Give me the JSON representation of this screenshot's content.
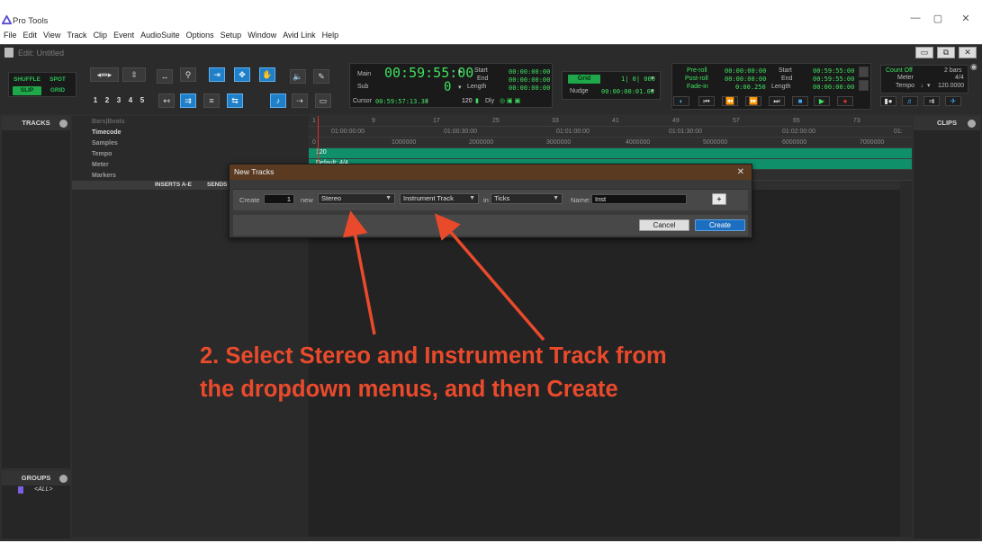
{
  "window": {
    "app_title": "Pro Tools",
    "minimize": "—",
    "maximize": "▢",
    "close": "✕"
  },
  "menu": [
    "File",
    "Edit",
    "View",
    "Track",
    "Clip",
    "Event",
    "AudioSuite",
    "Options",
    "Setup",
    "Window",
    "Avid Link",
    "Help"
  ],
  "edit_window": {
    "title": "Edit: Untitled"
  },
  "toolbar": {
    "modes": {
      "shuffle": "SHUFFLE",
      "spot": "SPOT",
      "slip": "SLIP",
      "grid": "GRID"
    },
    "zoom_presets": [
      "1",
      "2",
      "3",
      "4",
      "5"
    ],
    "counter": {
      "main_label": "Main",
      "main_value": "00:59:55:00",
      "sub_label": "Sub",
      "sub_value": "0",
      "start_label": "Start",
      "end_label": "End",
      "length_label": "Length",
      "start_value": "00:00:00:00",
      "end_value": "00:00:00:00",
      "length_value": "00:00:00:00",
      "cursor_label": "Cursor",
      "cursor_value": "00:59:57:13.38",
      "tempo_value": "120",
      "dly_label": "Dly"
    },
    "grid": {
      "grid_label": "Grid",
      "grid_value": "1| 0| 000",
      "nudge_label": "Nudge",
      "nudge_value": "00:00:00:01.00"
    },
    "transport": {
      "preroll_label": "Pre-roll",
      "postroll_label": "Post-roll",
      "fadein_label": "Fade-in",
      "preroll_value": "00:00:00:00",
      "postroll_value": "00:00:00:00",
      "fadein_value": "0:00.250",
      "start_label": "Start",
      "end_label": "End",
      "length_label": "Length",
      "start_value": "00:59:55:00",
      "end_value": "00:59:55:00",
      "length_value": "00:00:00:00"
    },
    "midi": {
      "count_label": "Count Off",
      "count_value": "2 bars",
      "meter_label": "Meter",
      "meter_value": "4/4",
      "tempo_label": "Tempo",
      "tempo_value": "120.0000"
    }
  },
  "panels": {
    "tracks": "TRACKS",
    "groups": "GROUPS",
    "groups_all": "<ALL>",
    "clips": "CLIPS"
  },
  "rulers": {
    "labels": [
      "Bars|Beats",
      "Timecode",
      "Samples",
      "Tempo",
      "Meter",
      "Markers"
    ],
    "bars": [
      "1",
      "9",
      "17",
      "25",
      "33",
      "41",
      "49",
      "57",
      "65",
      "73"
    ],
    "timecode": [
      "01:00:00:00",
      "01:00:30:00",
      "01:01:00:00",
      "01:01:30:00",
      "01:02:00:00",
      "01:"
    ],
    "samples": [
      "0",
      "1000000",
      "2000000",
      "3000000",
      "4000000",
      "5000000",
      "6000000",
      "7000000"
    ],
    "tempo_marker": "120",
    "meter_marker": "Default: 4/4",
    "column_heads": [
      "INSERTS A-E",
      "SENDS"
    ]
  },
  "dialog": {
    "title": "New Tracks",
    "create_label": "Create",
    "count_value": "1",
    "new_label": "new",
    "format_value": "Stereo",
    "type_value": "Instrument Track",
    "in_label": "in",
    "timebase_value": "Ticks",
    "name_label": "Name:",
    "name_value": "Inst",
    "add_row": "+",
    "cancel": "Cancel",
    "create": "Create"
  },
  "annotation": {
    "line1": "2. Select Stereo and Instrument Track from",
    "line2": "the dropdown menus, and then Create",
    "color": "#ea4a2c"
  }
}
